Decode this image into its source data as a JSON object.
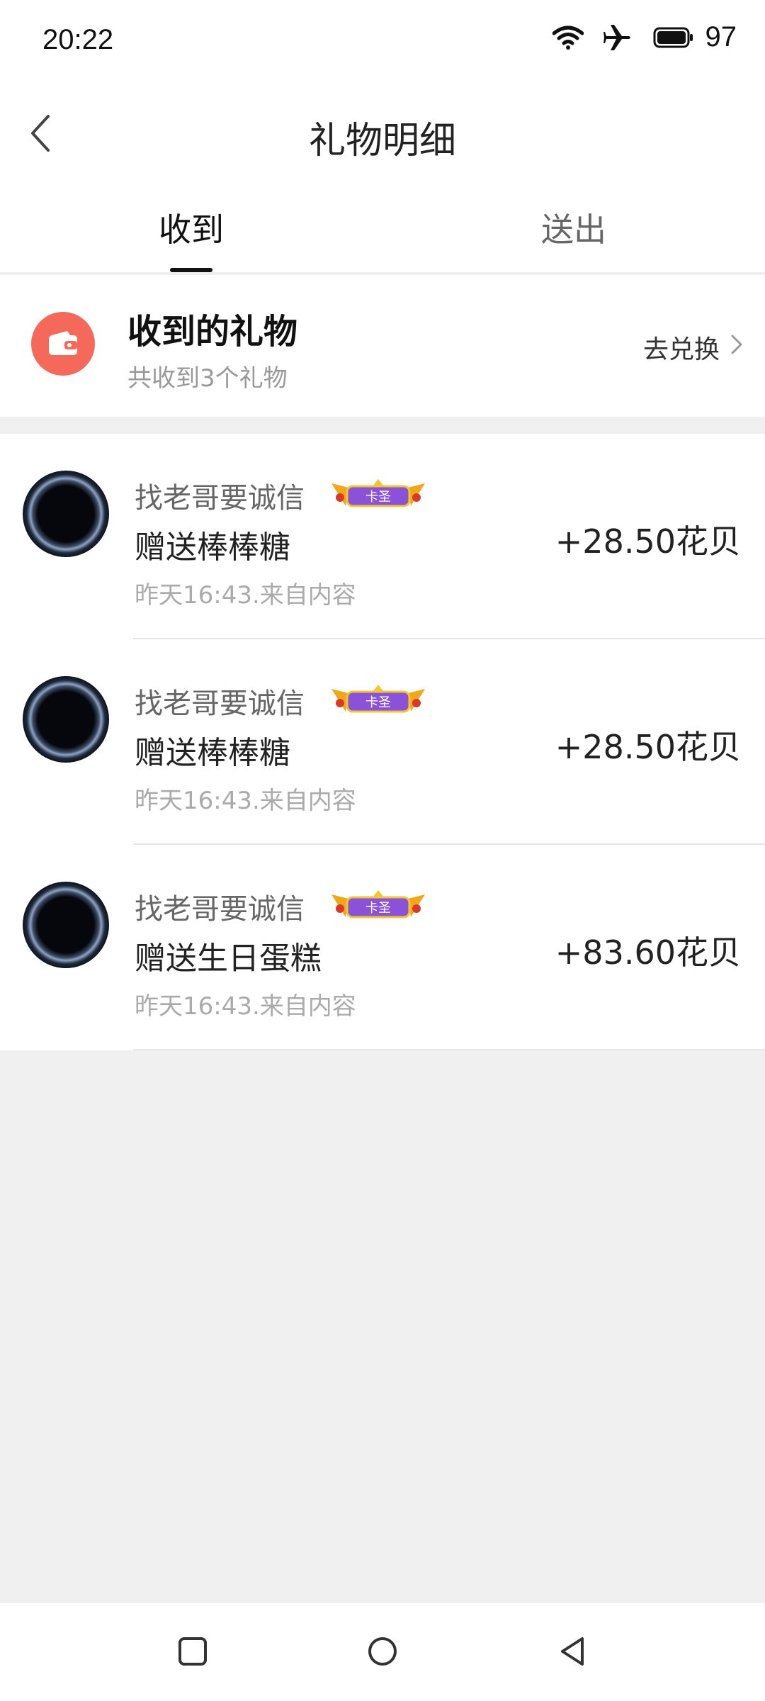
{
  "status": {
    "time": "20:22",
    "battery": "97",
    "icons": [
      "wifi-icon",
      "airplane-icon",
      "battery-icon"
    ]
  },
  "header": {
    "title": "礼物明细",
    "back_icon": "chevron-left-icon"
  },
  "tabs": [
    {
      "label": "收到",
      "active": true
    },
    {
      "label": "送出",
      "active": false
    }
  ],
  "summary": {
    "icon": "wallet-icon",
    "icon_color": "#f5695a",
    "title": "收到的礼物",
    "subtitle": "共收到3个礼物",
    "action": "去兑换"
  },
  "gifts": [
    {
      "sender": "找老哥要诚信",
      "badge": "卡圣",
      "gift": "赠送棒棒糖",
      "time": "昨天16:43.来自内容",
      "amount": "+28.50花贝"
    },
    {
      "sender": "找老哥要诚信",
      "badge": "卡圣",
      "gift": "赠送棒棒糖",
      "time": "昨天16:43.来自内容",
      "amount": "+28.50花贝"
    },
    {
      "sender": "找老哥要诚信",
      "badge": "卡圣",
      "gift": "赠送生日蛋糕",
      "time": "昨天16:43.来自内容",
      "amount": "+83.60花贝"
    }
  ],
  "system_nav": [
    "recents-icon",
    "home-icon",
    "back-icon"
  ]
}
